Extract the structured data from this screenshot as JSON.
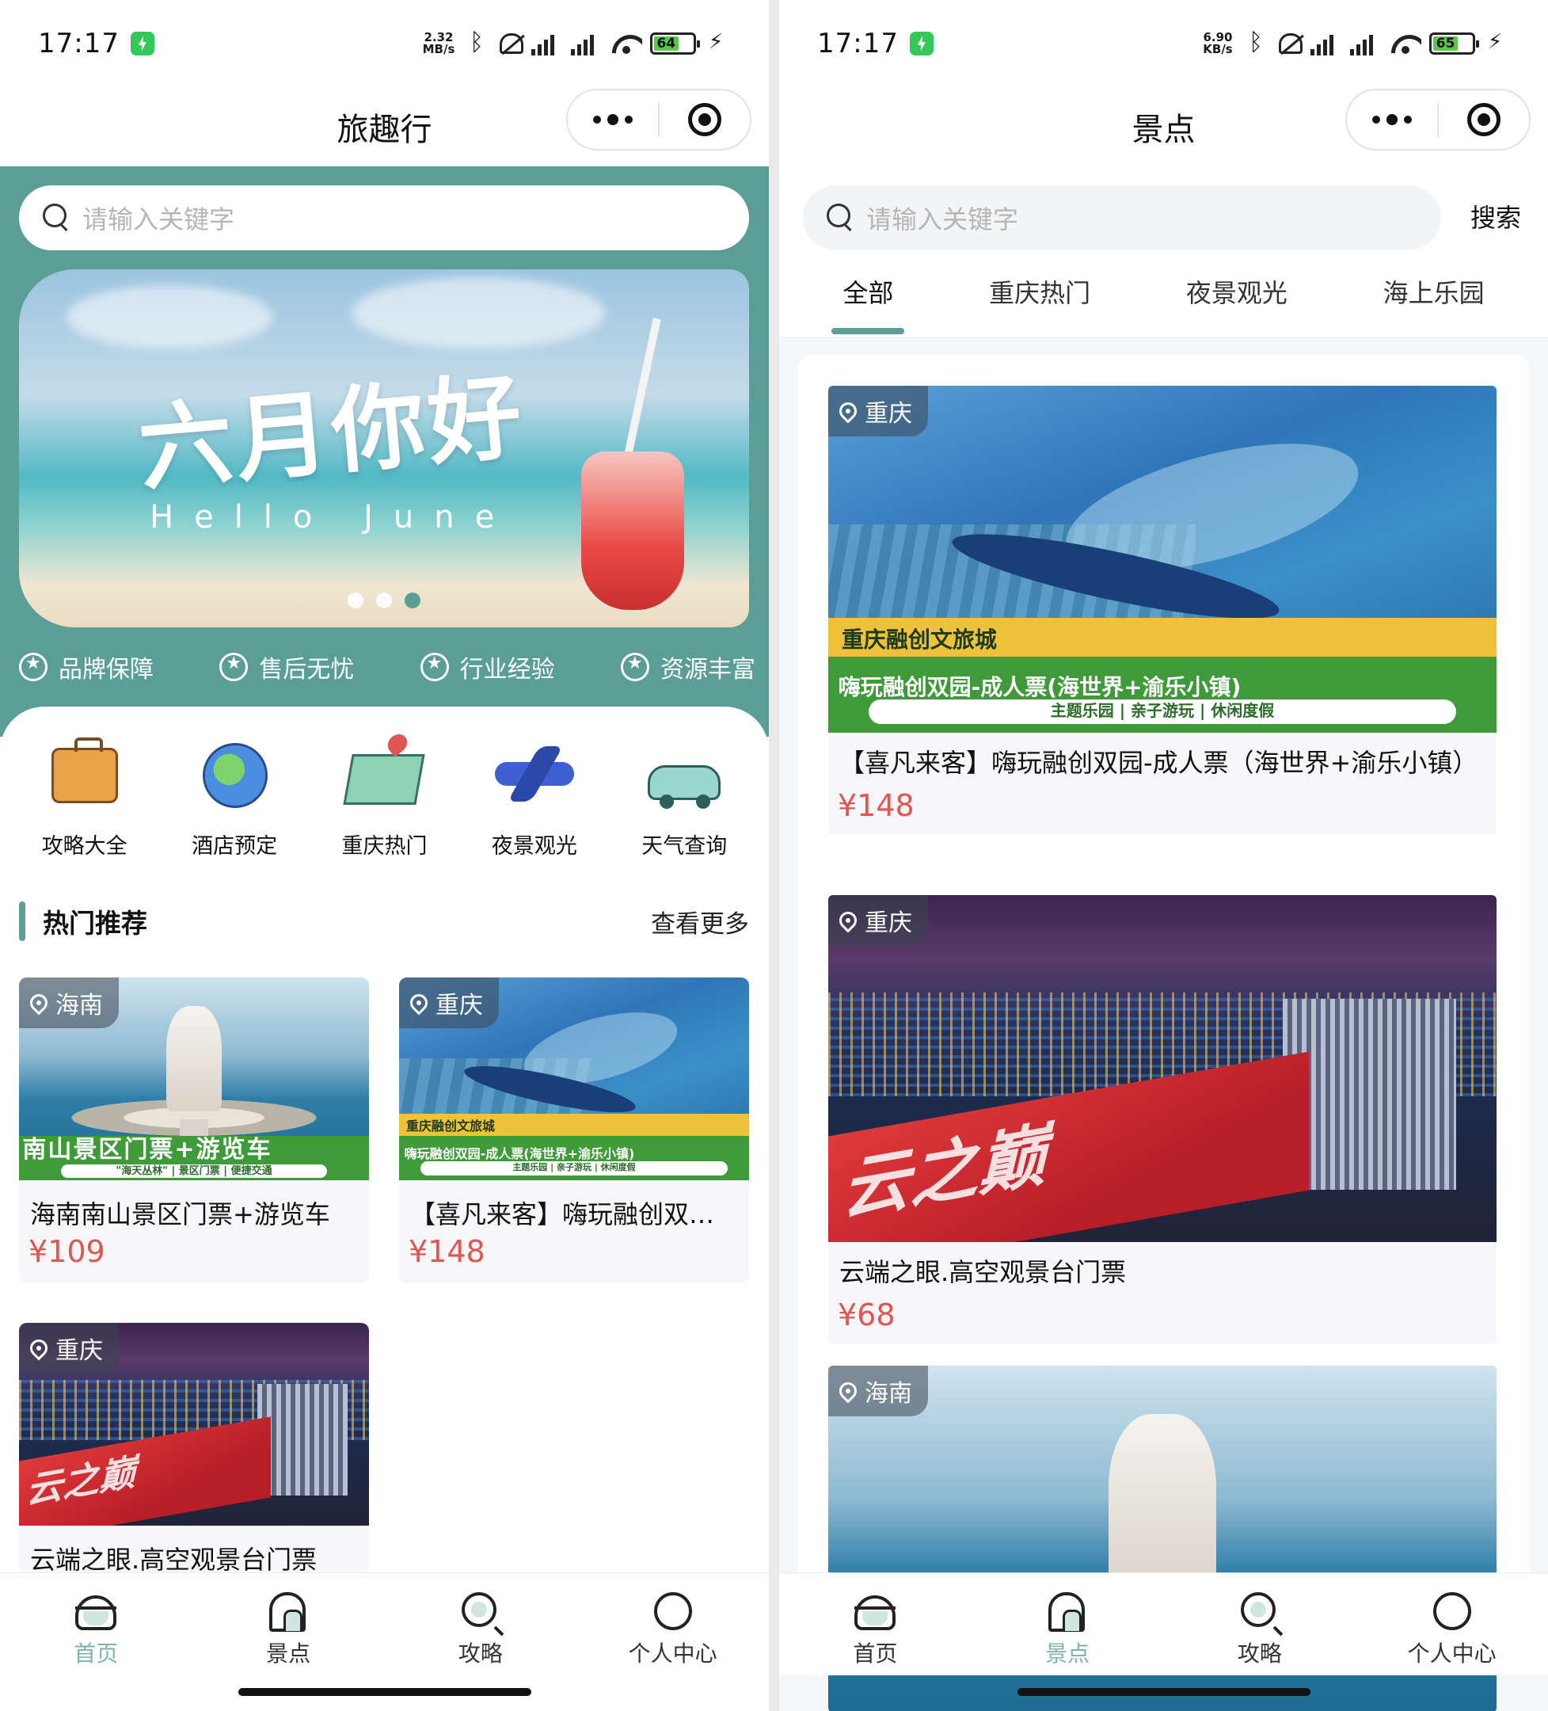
{
  "status_left": {
    "time": "17:17",
    "net_speed_top": "2.32",
    "net_speed_bottom": "MB/s",
    "battery": "64"
  },
  "status_right": {
    "time": "17:17",
    "net_speed_top": "6.90",
    "net_speed_bottom": "KB/s",
    "battery": "65"
  },
  "home": {
    "nav_title": "旅趣行",
    "search_placeholder": "请输入关键字",
    "banner": {
      "title": "六月你好",
      "subtitle": "Hello June",
      "dots": 3,
      "active_dot": 3
    },
    "features": [
      {
        "label": "品牌保障",
        "icon": "badge-icon"
      },
      {
        "label": "售后无忧",
        "icon": "badge-icon"
      },
      {
        "label": "行业经验",
        "icon": "badge-icon"
      },
      {
        "label": "资源丰富",
        "icon": "badge-icon"
      }
    ],
    "categories": [
      {
        "label": "攻略大全",
        "icon": "suitcase-icon"
      },
      {
        "label": "酒店预定",
        "icon": "globe-icon"
      },
      {
        "label": "重庆热门",
        "icon": "map-pin-icon"
      },
      {
        "label": "夜景观光",
        "icon": "airplane-icon"
      },
      {
        "label": "天气查询",
        "icon": "car-icon"
      }
    ],
    "section": {
      "title": "热门推荐",
      "more": "查看更多"
    },
    "hot": [
      {
        "location": "海南",
        "title": "海南南山景区门票+游览车",
        "price": "¥109",
        "image": {
          "caption": "南山景区门票+游览车",
          "subcaption": "\"海天丛林\" | 景区门票 | 便捷交通"
        }
      },
      {
        "location": "重庆",
        "title": "【喜凡来客】嗨玩融创双…",
        "price": "¥148",
        "image": {
          "band": "重庆融创文旅城",
          "headline": "嗨玩融创双园-成人票(海世界+渝乐小镇)",
          "tags": "主题乐园 | 亲子游玩 | 休闲度假"
        }
      },
      {
        "location": "重庆",
        "title": "云端之眼.高空观景台门票",
        "price": "",
        "image": {
          "deck_text": "云之巅"
        }
      }
    ]
  },
  "spots": {
    "nav_title": "景点",
    "search_placeholder": "请输入关键字",
    "search_button": "搜索",
    "tabs": [
      "全部",
      "重庆热门",
      "夜景观光",
      "海上乐园"
    ],
    "active_tab": "全部",
    "list": [
      {
        "location": "重庆",
        "title": "【喜凡来客】嗨玩融创双园-成人票（海世界+渝乐小镇）",
        "price": "¥148",
        "image": {
          "band": "重庆融创文旅城",
          "headline": "嗨玩融创双园-成人票(海世界+渝乐小镇)",
          "tags": "主题乐园 | 亲子游玩 | 休闲度假"
        }
      },
      {
        "location": "重庆",
        "title": "云端之眼.高空观景台门票",
        "price": "¥68",
        "image": {
          "deck_text": "云之巅"
        }
      },
      {
        "location": "海南",
        "title": "",
        "price": ""
      }
    ]
  },
  "tabbar": [
    {
      "label": "首页",
      "icon": "home-icon"
    },
    {
      "label": "景点",
      "icon": "spot-icon"
    },
    {
      "label": "攻略",
      "icon": "guide-icon"
    },
    {
      "label": "个人中心",
      "icon": "user-icon"
    }
  ],
  "colors": {
    "primary": "#5a9e96",
    "price": "#e25550",
    "tab_active": "#7fb3ac"
  }
}
